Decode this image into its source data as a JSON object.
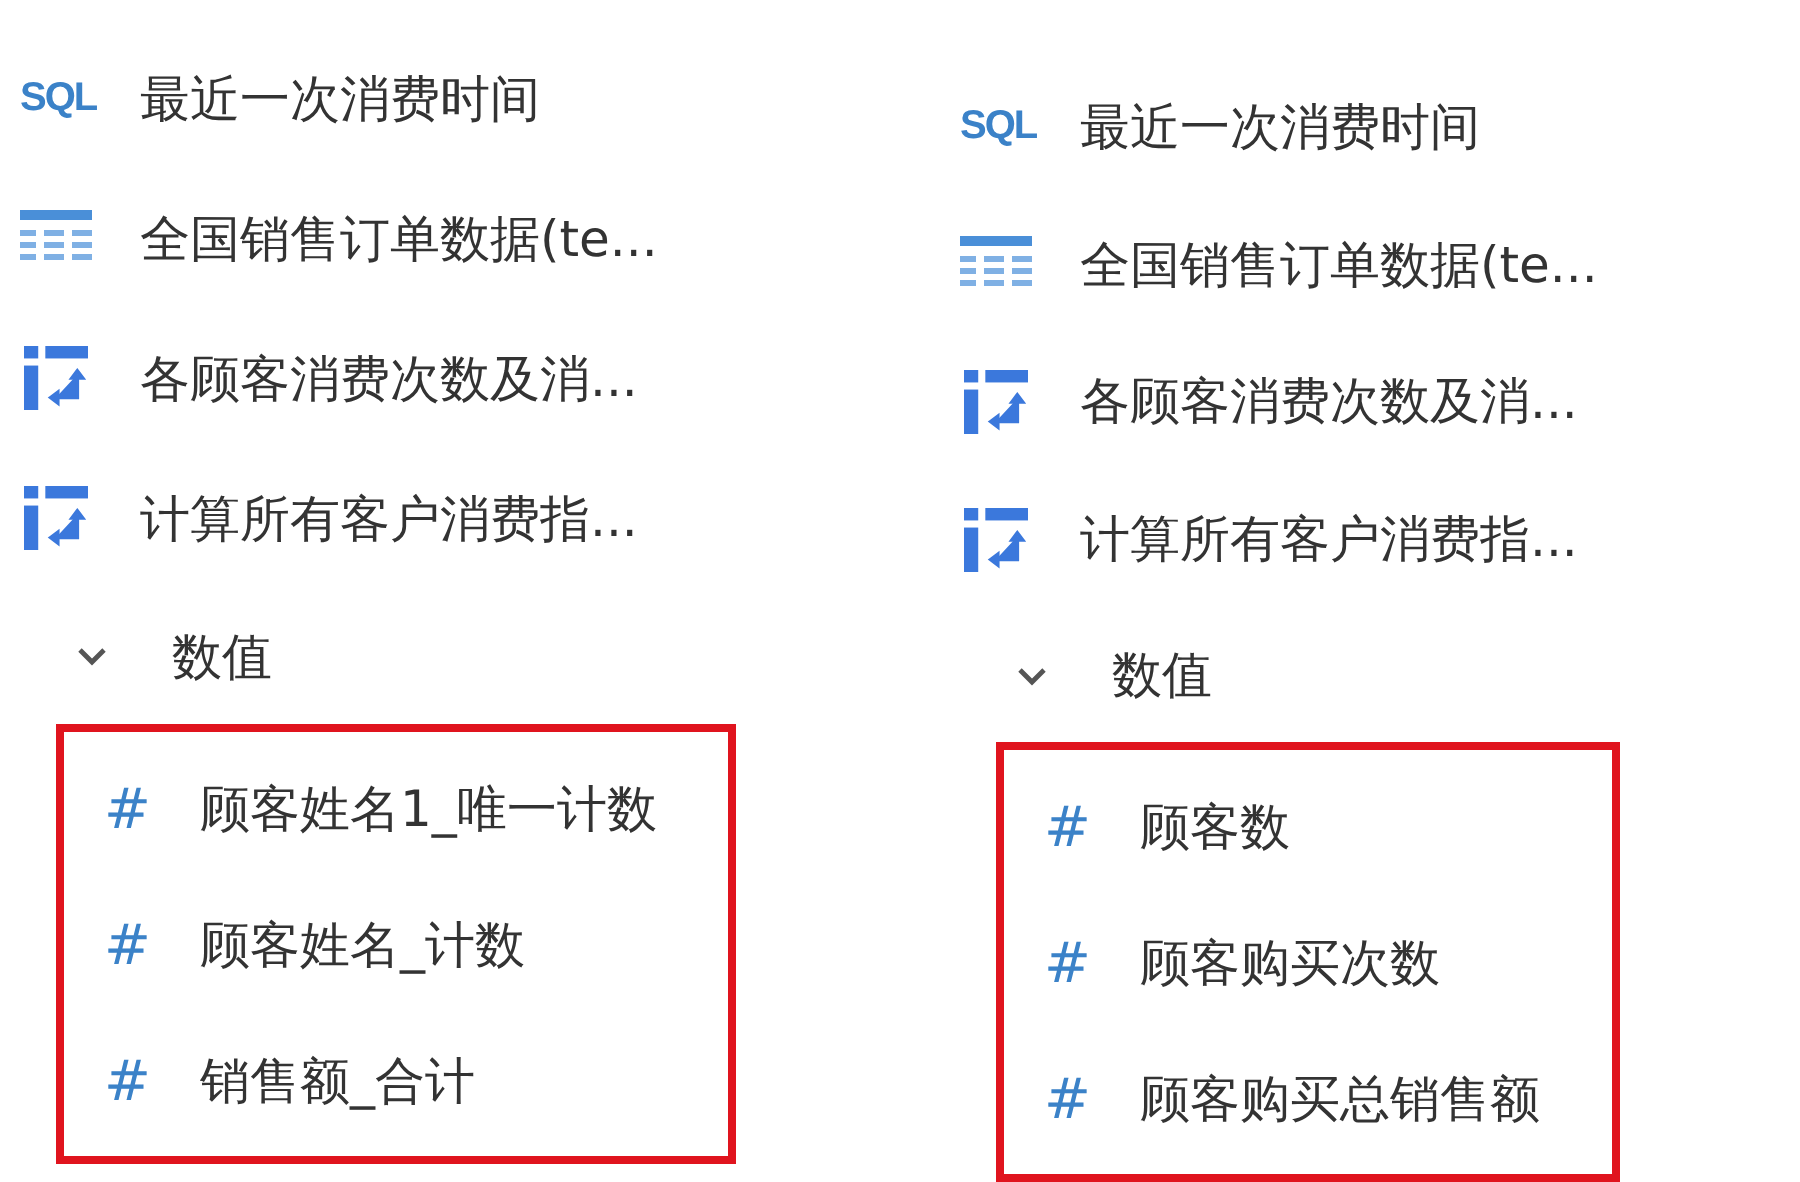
{
  "panels": [
    {
      "items": [
        {
          "kind": "sql",
          "icon_text": "SQL",
          "label": "最近一次消费时间"
        },
        {
          "kind": "table",
          "label": "全国销售订单数据(te..."
        },
        {
          "kind": "transform",
          "label": "各顾客消费次数及消..."
        },
        {
          "kind": "transform",
          "label": "计算所有客户消费指..."
        }
      ],
      "group": {
        "label": "数值",
        "expanded": true,
        "highlighted": true,
        "fields": [
          {
            "icon_text": "#",
            "label": "顾客姓名1_唯一计数"
          },
          {
            "icon_text": "#",
            "label": "顾客姓名_计数"
          },
          {
            "icon_text": "#",
            "label": "销售额_合计"
          }
        ]
      }
    },
    {
      "items": [
        {
          "kind": "sql",
          "icon_text": "SQL",
          "label": "最近一次消费时间"
        },
        {
          "kind": "table",
          "label": "全国销售订单数据(te..."
        },
        {
          "kind": "transform",
          "label": "各顾客消费次数及消..."
        },
        {
          "kind": "transform",
          "label": "计算所有客户消费指..."
        }
      ],
      "group": {
        "label": "数值",
        "expanded": true,
        "highlighted": true,
        "fields": [
          {
            "icon_text": "#",
            "label": "顾客数"
          },
          {
            "icon_text": "#",
            "label": "顾客购买次数"
          },
          {
            "icon_text": "#",
            "label": "顾客购买总销售额"
          }
        ]
      }
    }
  ]
}
